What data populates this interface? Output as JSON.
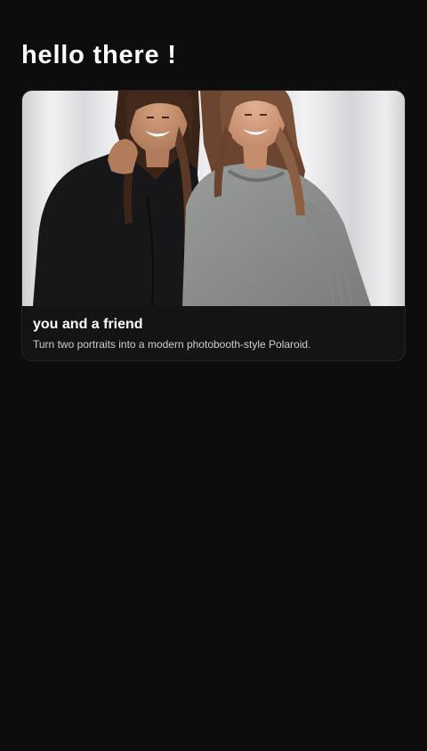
{
  "greeting": "hello there !",
  "cards": [
    {
      "title": "you and a friend",
      "description": "Turn two portraits into a modern photobooth-style Polaroid."
    }
  ],
  "colors": {
    "background": "#0d0d0e",
    "card_background": "#141415",
    "card_border": "#262628",
    "title_text": "#ffffff",
    "description_text": "#cfcfd2"
  }
}
